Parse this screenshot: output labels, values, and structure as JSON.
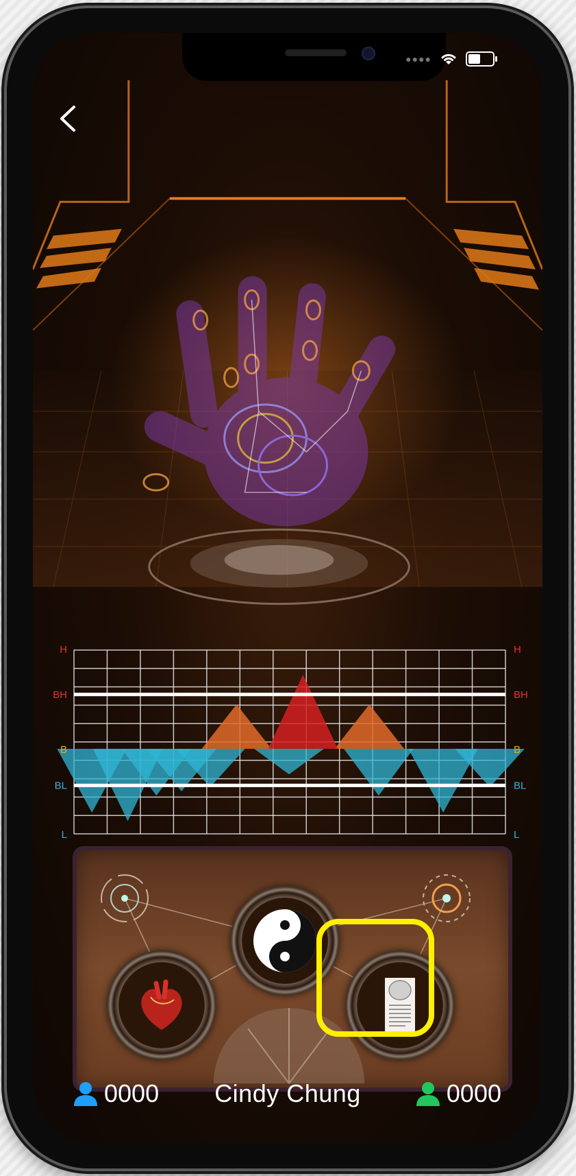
{
  "chart_data": {
    "type": "area",
    "ytick_labels": [
      "H",
      "BH",
      "B",
      "BL",
      "L"
    ],
    "baseline": "B",
    "grid": true,
    "series": [
      {
        "color": "#2fb5d6",
        "peaks": [
          -0.75,
          -0.85,
          -0.55,
          -0.5,
          -0.45,
          -0.3,
          -0.55,
          -0.75,
          -0.45
        ]
      },
      {
        "color": "#e06a2a",
        "peaks": [
          0.45,
          0.45
        ]
      },
      {
        "color": "#d42020",
        "peaks": [
          0.75
        ]
      }
    ]
  },
  "header": {
    "back_label": "<"
  },
  "footer": {
    "left_count": "0000",
    "user_name": "Cindy Chung",
    "right_count": "0000"
  },
  "colors": {
    "left_user_icon": "#1fa0ff",
    "right_user_icon": "#22c55e",
    "highlight": "#ffef00"
  },
  "panel": {
    "nodes": [
      "heart-icon",
      "yin-yang-icon",
      "report-icon"
    ]
  }
}
